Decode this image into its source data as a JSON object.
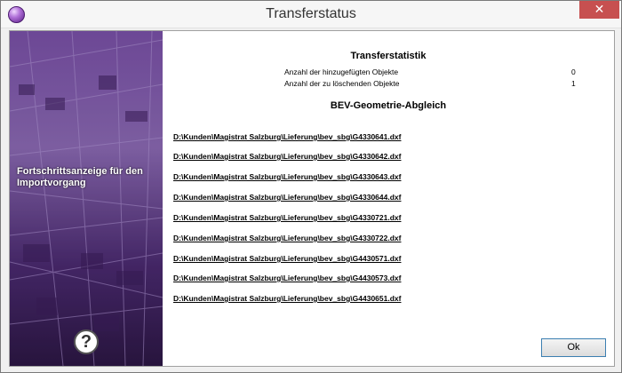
{
  "window": {
    "title": "Transferstatus",
    "close_label": "✕"
  },
  "sidebar": {
    "caption": "Fortschrittsanzeige für den Importvorgang",
    "help_label": "?"
  },
  "statistics": {
    "title": "Transferstatistik",
    "rows": [
      {
        "label": "Anzahl der hinzugefügten Objekte",
        "value": "0"
      },
      {
        "label": "Anzahl der zu löschenden Objekte",
        "value": "1"
      }
    ]
  },
  "section": {
    "title": "BEV-Geometrie-Abgleich"
  },
  "files": [
    "D:\\Kunden\\Magistrat Salzburg\\Lieferung\\bev_sbg\\G4330641.dxf",
    "D:\\Kunden\\Magistrat Salzburg\\Lieferung\\bev_sbg\\G4330642.dxf",
    "D:\\Kunden\\Magistrat Salzburg\\Lieferung\\bev_sbg\\G4330643.dxf",
    "D:\\Kunden\\Magistrat Salzburg\\Lieferung\\bev_sbg\\G4330644.dxf",
    "D:\\Kunden\\Magistrat Salzburg\\Lieferung\\bev_sbg\\G4330721.dxf",
    "D:\\Kunden\\Magistrat Salzburg\\Lieferung\\bev_sbg\\G4330722.dxf",
    "D:\\Kunden\\Magistrat Salzburg\\Lieferung\\bev_sbg\\G4430571.dxf",
    "D:\\Kunden\\Magistrat Salzburg\\Lieferung\\bev_sbg\\G4430573.dxf",
    "D:\\Kunden\\Magistrat Salzburg\\Lieferung\\bev_sbg\\G4430651.dxf"
  ],
  "buttons": {
    "ok_label": "Ok"
  },
  "colors": {
    "sidebar_purple": "#6a3a9a",
    "close_red": "#c75050"
  }
}
